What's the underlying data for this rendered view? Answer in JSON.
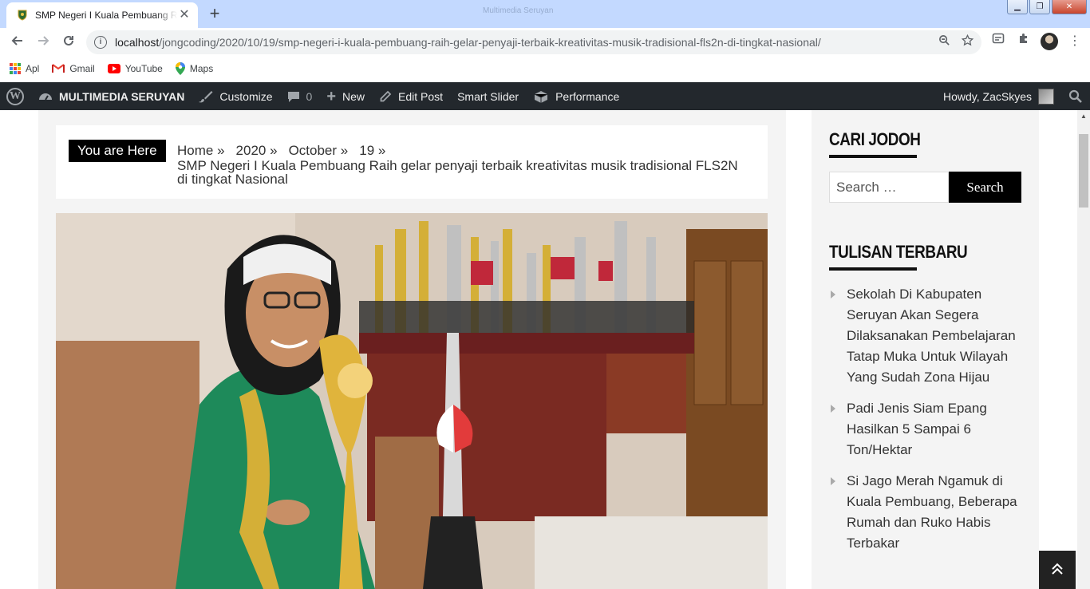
{
  "browser": {
    "tab_title": "SMP Negeri I Kuala Pembuang Raih gelar penyaji terbaik kreativitas musik tradisional FLS2N di tingkat Nasional",
    "window_title": "Multimedia Seruyan",
    "url_host": "localhost",
    "url_path": "/jongcoding/2020/10/19/smp-negeri-i-kuala-pembuang-raih-gelar-penyaji-terbaik-kreativitas-musik-tradisional-fls2n-di-tingkat-nasional/"
  },
  "bookmarks": [
    {
      "label": "Apl",
      "icon": "apps-icon"
    },
    {
      "label": "Gmail",
      "icon": "gmail-icon"
    },
    {
      "label": "YouTube",
      "icon": "youtube-icon"
    },
    {
      "label": "Maps",
      "icon": "maps-icon"
    }
  ],
  "adminbar": {
    "site_name": "MULTIMEDIA SERUYAN",
    "customize": "Customize",
    "comments_count": "0",
    "new": "New",
    "edit_post": "Edit Post",
    "smart_slider": "Smart Slider",
    "performance": "Performance",
    "howdy": "Howdy, ZacSkyes"
  },
  "breadcrumb": {
    "label": "You are Here",
    "items": [
      "Home",
      "2020",
      "October",
      "19"
    ],
    "current": "SMP Negeri I Kuala Pembuang Raih gelar penyaji terbaik kreativitas musik tradisional FLS2N di tingkat Nasional"
  },
  "sidebar": {
    "widget1_title": "CARI JODOH",
    "search_placeholder": "Search …",
    "search_button": "Search",
    "widget2_title": "TULISAN TERBARU",
    "posts": [
      "Sekolah Di Kabupaten Seruyan Akan Segera Dilaksanakan Pembelajaran Tatap Muka Untuk Wilayah Yang Sudah Zona Hijau",
      "Padi Jenis Siam Epang Hasilkan 5 Sampai 6 Ton/Hektar",
      "Si Jago Merah Ngamuk di Kuala Pembuang, Beberapa Rumah dan Ruko Habis Terbakar"
    ]
  },
  "colors": {
    "tabstrip": "#c3d9ff",
    "adminbar": "#23282d",
    "content_bg": "#f4f4f4",
    "accent_black": "#000000"
  }
}
